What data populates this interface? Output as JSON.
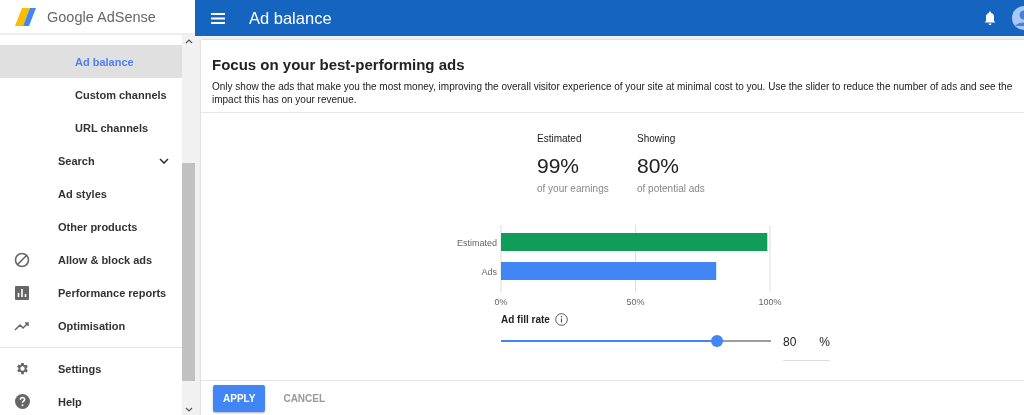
{
  "sidebar": {
    "logo": "Google AdSense",
    "groups": [
      [
        {
          "label": "Ad balance",
          "kind": "sub",
          "selected": true
        },
        {
          "label": "Custom channels",
          "kind": "sub",
          "selected": false
        },
        {
          "label": "URL channels",
          "kind": "sub",
          "selected": false
        },
        {
          "label": "Search",
          "kind": "expandable",
          "selected": false
        },
        {
          "label": "Ad styles",
          "kind": "item",
          "selected": false
        },
        {
          "label": "Other products",
          "kind": "item",
          "selected": false
        },
        {
          "label": "Allow & block ads",
          "kind": "icon",
          "selected": false
        },
        {
          "label": "Performance reports",
          "kind": "icon",
          "selected": false
        },
        {
          "label": "Optimisation",
          "kind": "icon",
          "selected": false
        }
      ],
      [
        {
          "label": "Settings",
          "kind": "icon",
          "selected": false
        },
        {
          "label": "Help",
          "kind": "icon",
          "selected": false
        }
      ]
    ]
  },
  "topbar": {
    "title": "Ad balance"
  },
  "card": {
    "title": "Focus on your best-performing ads",
    "description": "Only show the ads that make you the most money, improving the overall visitor experience of your site at minimal cost to you. Use the slider to reduce the number of ads and see the impact this has on your revenue.",
    "stats": [
      {
        "label": "Estimated",
        "value": "99%",
        "caption": "of your earnings"
      },
      {
        "label": "Showing",
        "value": "80%",
        "caption": "of potential ads"
      }
    ],
    "chart_data": {
      "type": "bar",
      "orientation": "horizontal",
      "series": [
        {
          "name": "Estimated",
          "color": "#0f9d58",
          "values": [
            99
          ]
        },
        {
          "name": "Ads",
          "color": "#4285f4",
          "values": [
            80
          ]
        }
      ],
      "xlim": [
        0,
        100
      ],
      "xticks": [
        {
          "value": 0,
          "label": "0%"
        },
        {
          "value": 50,
          "label": "50%"
        },
        {
          "value": 100,
          "label": "100%"
        }
      ]
    }
  },
  "slider": {
    "label": "Ad fill rate",
    "level": 0.8,
    "value": "80",
    "unit": "%"
  },
  "buttons": [
    {
      "label": "APPLY",
      "kind": "primary"
    },
    {
      "label": "CANCEL",
      "kind": "flat"
    }
  ]
}
